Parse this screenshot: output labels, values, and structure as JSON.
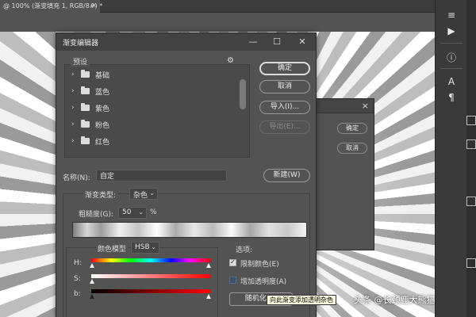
{
  "document": {
    "tab_title": "@ 100% (渐变填充 1, RGB/8#) *",
    "tab_close": "×"
  },
  "toolbar": {
    "icons": [
      "menu-lines-icon",
      "collapse-arrow-icon",
      "play-icon",
      "info-icon",
      "text-a-icon",
      "paragraph-icon"
    ]
  },
  "dialog": {
    "title": "渐变编辑器",
    "presets_label": "预设",
    "presets": [
      {
        "label": "基础"
      },
      {
        "label": "蓝色"
      },
      {
        "label": "紫色"
      },
      {
        "label": "粉色"
      },
      {
        "label": "红色"
      }
    ],
    "buttons": {
      "ok": "确定",
      "cancel": "取消",
      "import": "导入(I)...",
      "export": "导出(E)...",
      "new": "新建(W)"
    },
    "name_label": "名称(N):",
    "name_value": "自定",
    "gradient_type_label": "渐变类型:",
    "gradient_type_value": "杂色",
    "roughness_label": "粗糙度(G):",
    "roughness_value": "50",
    "roughness_unit": "%",
    "color_model_label": "颜色模型",
    "color_model_value": "HSB",
    "channels": [
      {
        "label": "H:"
      },
      {
        "label": "S:"
      },
      {
        "label": "b:"
      }
    ],
    "options_label": "选项:",
    "restrict_colors_label": "限制颜色(E)",
    "restrict_colors_checked": true,
    "add_transparency_label": "增加透明度(A)",
    "add_transparency_checked": false,
    "randomize_label": "随机化(Z)",
    "tooltip": "向此渐变添加透明杂色"
  },
  "background_dialog": {
    "close": "×",
    "ok": "确定",
    "cancel": "取消"
  },
  "watermark": "头条 @长颈鹿大熊猫"
}
